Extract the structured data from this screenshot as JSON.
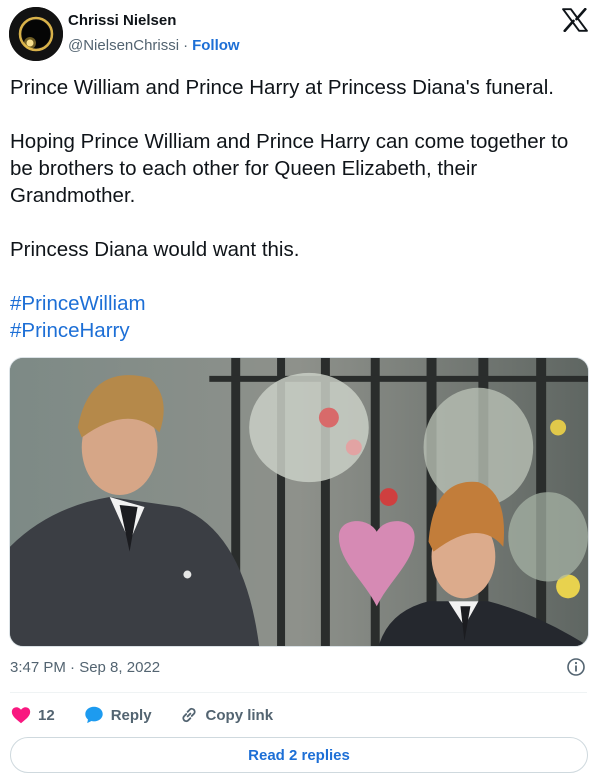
{
  "author": {
    "name": "Chrissi Nielsen",
    "handle": "@NielsenChrissi",
    "separator": "·",
    "follow_label": "Follow"
  },
  "tweet": {
    "paragraphs": [
      "Prince William and Prince Harry at Princess Diana's funeral.",
      "Hoping Prince William and Prince Harry can come together to be brothers to each other for Queen Elizabeth, their Grandmother.",
      "Princess Diana would want this."
    ],
    "hashtags": [
      "#PrinceWilliam",
      "#PrinceHarry"
    ]
  },
  "meta": {
    "timestamp": "3:47 PM · Sep 8, 2022"
  },
  "actions": {
    "like_count": "12",
    "reply_label": "Reply",
    "copy_link_label": "Copy link"
  },
  "footer": {
    "read_replies_label": "Read 2 replies"
  },
  "colors": {
    "link": "#1d6fd6",
    "like": "#f91880",
    "reply_icon": "#1d9bf0",
    "muted": "#536471"
  },
  "icons": {
    "brand": "x-logo-icon",
    "info": "info-icon",
    "like": "heart-icon",
    "reply": "speech-bubble-icon",
    "copy_link": "link-icon"
  }
}
